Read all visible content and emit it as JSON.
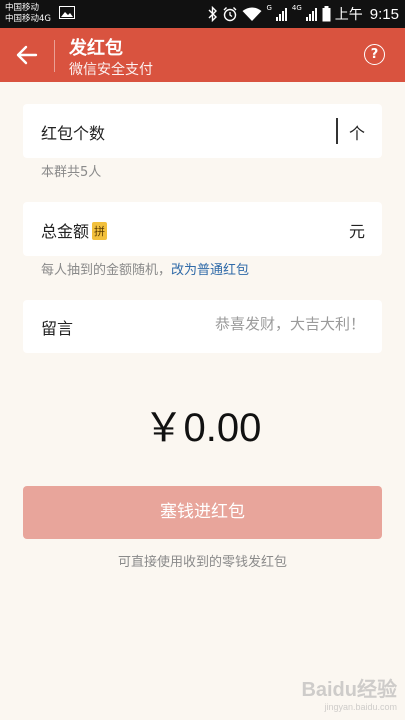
{
  "status_bar": {
    "carrier_1": "中国移动",
    "carrier_2": "中国移动4G",
    "network_1": "G",
    "network_2": "4G",
    "time_prefix": "上午",
    "time": "9:15"
  },
  "header": {
    "title": "发红包",
    "subtitle": "微信安全支付",
    "help": "?"
  },
  "count_field": {
    "label": "红包个数",
    "unit": "个",
    "hint": "本群共5人"
  },
  "amount_field": {
    "label": "总金额",
    "badge": "拼",
    "unit": "元",
    "hint": "每人抽到的金额随机，",
    "hint_link": "改为普通红包"
  },
  "message_field": {
    "label": "留言",
    "placeholder": "恭喜发财，大吉大利！"
  },
  "total_display": "￥0.00",
  "submit_label": "塞钱进红包",
  "footer_hint": "可直接使用收到的零钱发红包",
  "watermark": "Baidu经验",
  "watermark_sub": "jingyan.baidu.com",
  "colors": {
    "header": "#d9533f",
    "button": "#e8a59b",
    "background": "#fbf7f1",
    "link": "#2f6aa8",
    "badge": "#f2c03c"
  },
  "icons": [
    "back-arrow-icon",
    "help-icon",
    "bluetooth-icon",
    "alarm-icon",
    "wifi-icon",
    "signal-icon",
    "battery-icon",
    "image-notification-icon"
  ]
}
